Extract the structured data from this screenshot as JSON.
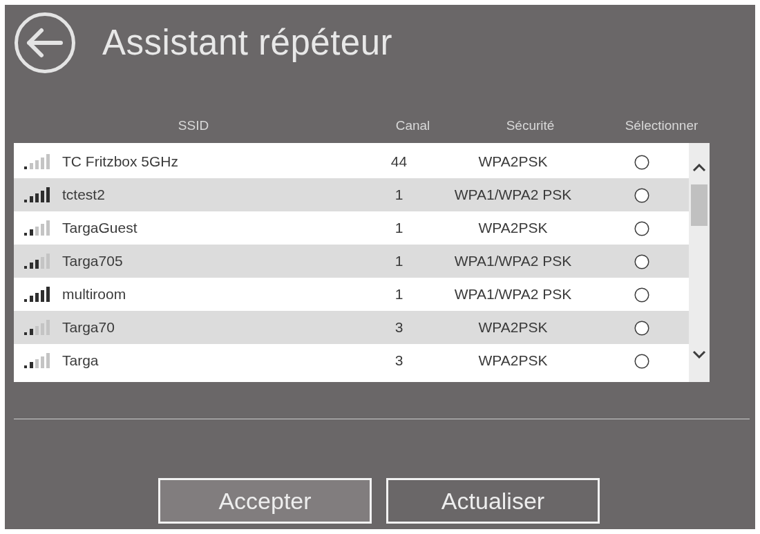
{
  "window": {
    "title": "Assistant répéteur"
  },
  "table": {
    "columns": [
      "SSID",
      "Canal",
      "Sécurité",
      "Sélectionner"
    ],
    "rows": [
      {
        "signal_icon": {
          "kind": "weak"
        },
        "ssid": "TC Fritzbox 5GHz",
        "channel": "44",
        "security": "WPA2PSK",
        "selected": false
      },
      {
        "signal_icon": {
          "kind": "excellent"
        },
        "ssid": "tctest2",
        "channel": "1",
        "security": "WPA1/WPA2 PSK",
        "selected": false
      },
      {
        "signal_icon": {
          "kind": "fair"
        },
        "ssid": "TargaGuest",
        "channel": "1",
        "security": "WPA2PSK",
        "selected": false
      },
      {
        "signal_icon": {
          "kind": "good"
        },
        "ssid": "Targa705",
        "channel": "1",
        "security": "WPA1/WPA2 PSK",
        "selected": false
      },
      {
        "signal_icon": {
          "kind": "excellent"
        },
        "ssid": "multiroom",
        "channel": "1",
        "security": "WPA1/WPA2 PSK",
        "selected": false
      },
      {
        "signal_icon": {
          "kind": "fair"
        },
        "ssid": "Targa70",
        "channel": "3",
        "security": "WPA2PSK",
        "selected": false
      },
      {
        "signal_icon": {
          "kind": "fair"
        },
        "ssid": "Targa",
        "channel": "3",
        "security": "WPA2PSK",
        "selected": false
      }
    ]
  },
  "buttons": [
    {
      "label": "Accepter",
      "focused": true
    },
    {
      "label": "Actualiser",
      "focused": false
    }
  ]
}
